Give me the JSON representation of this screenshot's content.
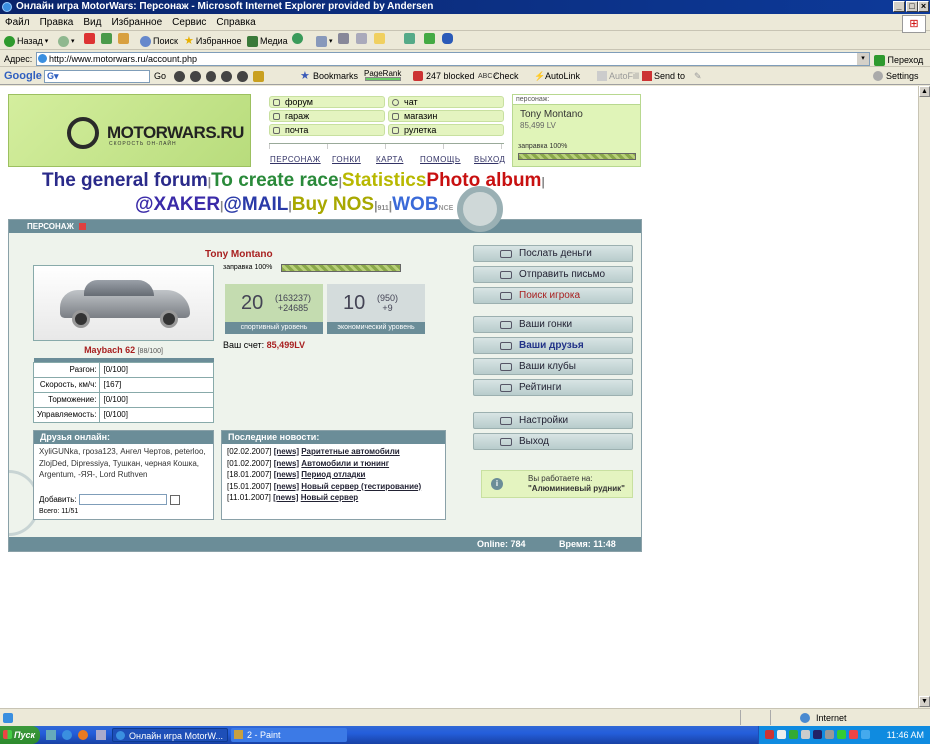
{
  "window": {
    "title": "Онлайн игра MotorWars: Персонаж - Microsoft Internet Explorer provided by Andersen",
    "menu": [
      "Файл",
      "Правка",
      "Вид",
      "Избранное",
      "Сервис",
      "Справка"
    ]
  },
  "toolbar": {
    "back": "Назад",
    "search": "Поиск",
    "favorites": "Избранное",
    "media": "Медиа"
  },
  "address": {
    "label": "Адрес:",
    "url": "http://www.motorwars.ru/account.php",
    "go": "Переход"
  },
  "googlebar": {
    "logo": "Google",
    "go": "Go",
    "bookmarks": "Bookmarks",
    "pagerank": "PageRank",
    "blocked": "247 blocked",
    "check": "Check",
    "autolink": "AutoLink",
    "autofill": "AutoFill",
    "sendto": "Send to",
    "settings": "Settings"
  },
  "site": {
    "logo_text": "MOTORWARS.RU",
    "logo_sub": "СКОРОСТЬ ОН-ЛАЙН",
    "nav": {
      "forum": "форум",
      "chat": "чат",
      "garage": "гараж",
      "shop": "магазин",
      "mail": "почта",
      "roulette": "рулетка"
    },
    "navlinks": [
      "ПЕРСОНАЖ",
      "ГОНКИ",
      "КАРТА",
      "ПОМОЩЬ",
      "ВЫХОД"
    ],
    "char_label": "персонаж:",
    "char_name": "Tony Montano",
    "char_money": "85,499 LV",
    "fuel_label": "заправка 100%",
    "banner1": {
      "forum": "The general forum",
      "race": "To create race",
      "stats": "Statistics",
      "photo": "Photo album"
    },
    "banner2": {
      "xaker": "@XAKER",
      "mail": "@MAIL",
      "nos": "Buy NOS",
      "small": "911",
      "wob": "WOB",
      "nce": "NCE"
    },
    "panel_title": "ПЕРСОНАЖ",
    "player_name": "Tony Montano",
    "car_name": "Maybach 62",
    "car_cond": "[88/100]",
    "stats": [
      {
        "label": "Разгон:",
        "value": "[0/100]"
      },
      {
        "label": "Скорость, км/ч:",
        "value": "[167]"
      },
      {
        "label": "Торможение:",
        "value": "[0/100]"
      },
      {
        "label": "Управляемость:",
        "value": "[0/100]"
      }
    ],
    "fuel": "заправка 100%",
    "sport_level": "20",
    "sport_points": "(163237)",
    "sport_delta": "+24685",
    "sport_label": "спортивный уровень",
    "eco_level": "10",
    "eco_points": "(950)",
    "eco_delta": "+9",
    "eco_label": "экономический уровень",
    "account_label": "Ваш счет:",
    "account_value": "85,499LV",
    "friends_title": "Друзья онлайн:",
    "friends_text": "XyliGUNka, гроза123, Ангел Чертов, peterloo, ZlojDed, Dipressiya, Тушкан, черная Кошка, Argentum, -ЯЯ-, Lord Ruthven",
    "add_label": "Добавить:",
    "total_label": "Всего: 11/51",
    "news_title": "Последние новости:",
    "news": [
      {
        "date": "[02.02.2007]",
        "tag": "[news]",
        "text": "Раритетные автомобили"
      },
      {
        "date": "[01.02.2007]",
        "tag": "[news]",
        "text": "Автомобили и тюнинг"
      },
      {
        "date": "[18.01.2007]",
        "tag": "[news]",
        "text": "Период отладки"
      },
      {
        "date": "[15.01.2007]",
        "tag": "[news]",
        "text": "Новый сервер (тестирование)"
      },
      {
        "date": "[11.01.2007]",
        "tag": "[news]",
        "text": "Новый сервер"
      }
    ],
    "menu": {
      "send_money": "Послать деньги",
      "send_letter": "Отправить письмо",
      "find_player": "Поиск игрока",
      "your_races": "Ваши гонки",
      "your_friends": "Ваши друзья",
      "your_clubs": "Ваши клубы",
      "ratings": "Рейтинги",
      "settings": "Настройки",
      "exit": "Выход"
    },
    "work_label": "Вы работаете на:",
    "work_place": "\"Алюминиевый рудник\"",
    "online": "Online: 784",
    "time": "Время: 11:48"
  },
  "status": {
    "zone": "Internet"
  },
  "taskbar": {
    "start": "Пуск",
    "task1": "Онлайн игра MotorW...",
    "task2": "2 - Paint",
    "clock": "11:46 AM"
  }
}
